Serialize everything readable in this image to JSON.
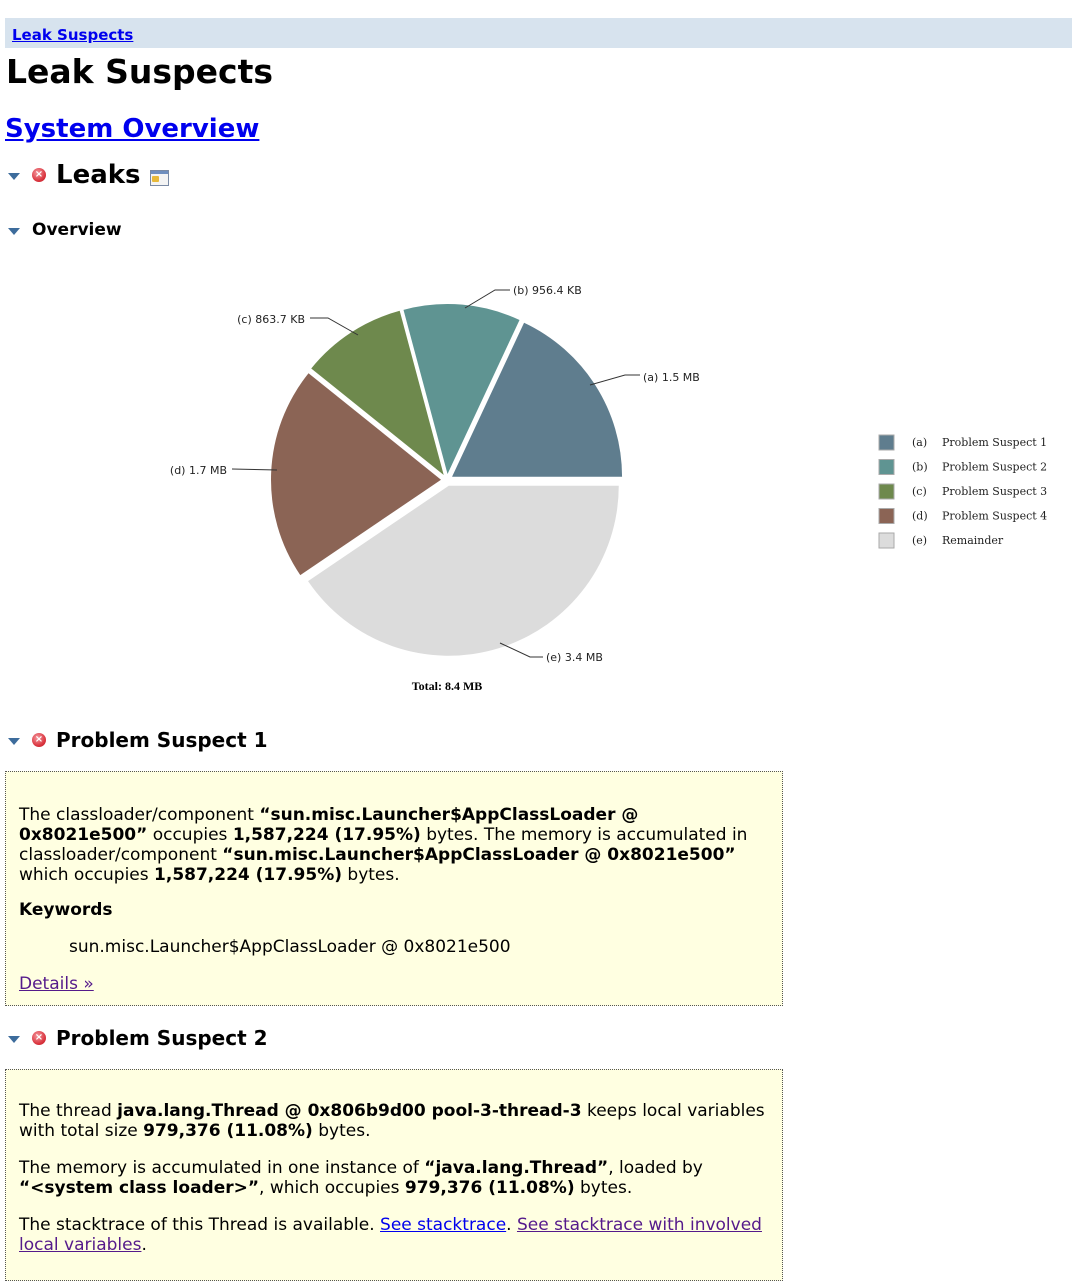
{
  "breadcrumb": {
    "label": "Leak Suspects"
  },
  "page_title": "Leak Suspects",
  "system_overview_link": "System Overview",
  "leaks_section": {
    "title": "Leaks"
  },
  "overview_section": {
    "title": "Overview"
  },
  "chart_data": {
    "type": "pie",
    "title": "",
    "total_label": "Total:  8.4  MB",
    "slices": [
      {
        "key": "(a)",
        "label": "Problem  Suspect  1",
        "value_label": "1.5  MB",
        "value_bytes": 1587224,
        "percent": 17.95,
        "color": "#5f7d8e"
      },
      {
        "key": "(b)",
        "label": "Problem  Suspect  2",
        "value_label": "956.4  KB",
        "value_bytes": 979376,
        "percent": 11.08,
        "color": "#5f9492"
      },
      {
        "key": "(c)",
        "label": "Problem  Suspect  3",
        "value_label": "863.7  KB",
        "value_bytes": 884429,
        "percent": 10.0,
        "color": "#6e894d"
      },
      {
        "key": "(d)",
        "label": "Problem  Suspect  4",
        "value_label": "1.7  MB",
        "value_bytes": 1782579,
        "percent": 20.2,
        "color": "#8b6455"
      },
      {
        "key": "(e)",
        "label": "Remainder",
        "value_label": "3.4  MB",
        "value_bytes": 3565158,
        "percent": 40.77,
        "color": "#dcdcdc"
      }
    ],
    "legend_position": "right"
  },
  "suspects": [
    {
      "title": "Problem Suspect 1",
      "paragraphs": [
        [
          {
            "t": "The classloader/component "
          },
          {
            "t": "“sun.misc.Launcher$AppClassLoader @ 0x8021e500”",
            "b": true
          },
          {
            "t": " occupies "
          },
          {
            "t": "1,587,224 (17.95%)",
            "b": true
          },
          {
            "t": " bytes. The memory is accumulated in classloader/component "
          },
          {
            "t": "“sun.misc.Launcher$AppClassLoader @ 0x8021e500”",
            "b": true
          },
          {
            "t": " which occupies "
          },
          {
            "t": "1,587,224 (17.95%)",
            "b": true
          },
          {
            "t": " bytes."
          }
        ]
      ],
      "keywords_title": "Keywords",
      "keywords": [
        "sun.misc.Launcher$AppClassLoader @ 0x8021e500"
      ],
      "details_link": "Details »"
    },
    {
      "title": "Problem Suspect 2",
      "paragraphs": [
        [
          {
            "t": "The thread "
          },
          {
            "t": "java.lang.Thread @ 0x806b9d00 pool-3-thread-3",
            "b": true
          },
          {
            "t": " keeps local variables with total size "
          },
          {
            "t": "979,376 (11.08%)",
            "b": true
          },
          {
            "t": " bytes."
          }
        ],
        [
          {
            "t": "The memory is accumulated in one instance of "
          },
          {
            "t": "“java.lang.Thread”",
            "b": true
          },
          {
            "t": ", loaded by "
          },
          {
            "t": "“<system class loader>”",
            "b": true
          },
          {
            "t": ", which occupies "
          },
          {
            "t": "979,376 (11.08%)",
            "b": true
          },
          {
            "t": " bytes."
          }
        ],
        [
          {
            "t": "The stacktrace of this Thread is available. "
          },
          {
            "t": "See stacktrace",
            "link": "blue"
          },
          {
            "t": ". "
          },
          {
            "t": "See stacktrace with involved local variables",
            "link": "visited"
          },
          {
            "t": "."
          }
        ]
      ]
    }
  ]
}
